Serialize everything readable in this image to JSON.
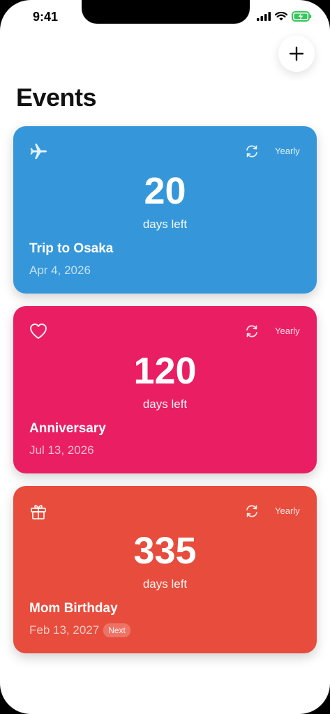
{
  "status_bar": {
    "time": "9:41"
  },
  "header": {
    "title": "Events",
    "add_icon": "plus-icon"
  },
  "events": [
    {
      "name": "Trip to Osaka",
      "date": "Apr 4, 2026",
      "count": "20",
      "count_label": "days left",
      "repeat": "Yearly",
      "icon": "airplane-icon",
      "color": "#3597D9"
    },
    {
      "name": "Anniversary",
      "date": "Jul 13, 2026",
      "count": "120",
      "count_label": "days left",
      "repeat": "Yearly",
      "icon": "heart-icon",
      "color": "#E91E63"
    },
    {
      "name": "Mom Birthday",
      "date": "Feb 13, 2027",
      "badge": "Next",
      "count": "335",
      "count_label": "days left",
      "repeat": "Yearly",
      "icon": "gift-icon",
      "color": "#E74C3C"
    }
  ]
}
